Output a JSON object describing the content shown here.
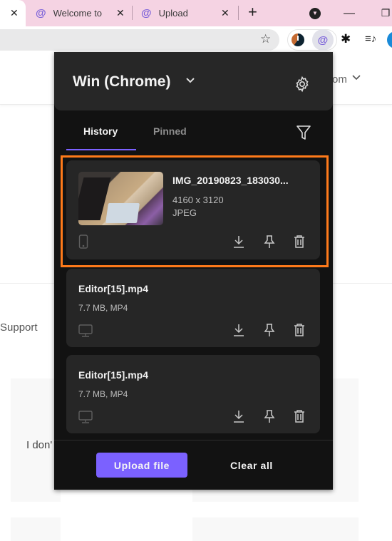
{
  "browser": {
    "tabs": [
      {
        "label": "",
        "close": "✕"
      },
      {
        "label": "Welcome to C",
        "close": "✕",
        "icon": "paperclip-icon"
      },
      {
        "label": "Upload",
        "close": "✕",
        "icon": "paperclip-icon"
      }
    ],
    "new_tab": "+",
    "window_controls": {
      "minimize": "—",
      "restore": "❐",
      "tab_search": "▼"
    },
    "toolbar": {
      "star": "☆",
      "puzzle": "✱",
      "media": "≡♪"
    }
  },
  "page": {
    "header_text": "om",
    "header_chevron": "⌄",
    "support_text": "Support",
    "faq_text": "I don'"
  },
  "popup": {
    "title": "Win (Chrome)",
    "tabs": [
      {
        "label": "History",
        "active": true
      },
      {
        "label": "Pinned",
        "active": false
      }
    ],
    "items": [
      {
        "title": "IMG_20190823_183030...",
        "line1": "4160 x 3120",
        "line2": "JPEG",
        "device": "phone-icon",
        "has_thumbnail": true
      },
      {
        "title": "Editor[15].mp4",
        "line1": "7.7 MB, MP4",
        "device": "desktop-icon"
      },
      {
        "title": "Editor[15].mp4",
        "line1": "7.7 MB, MP4",
        "device": "desktop-icon"
      }
    ],
    "upload_label": "Upload file",
    "clear_label": "Clear all"
  },
  "colors": {
    "accent": "#7b61ff",
    "highlight": "#ff7a1a",
    "popup_bg": "#121212",
    "card_bg": "#262626",
    "tabbar": "#f5d3e3"
  }
}
